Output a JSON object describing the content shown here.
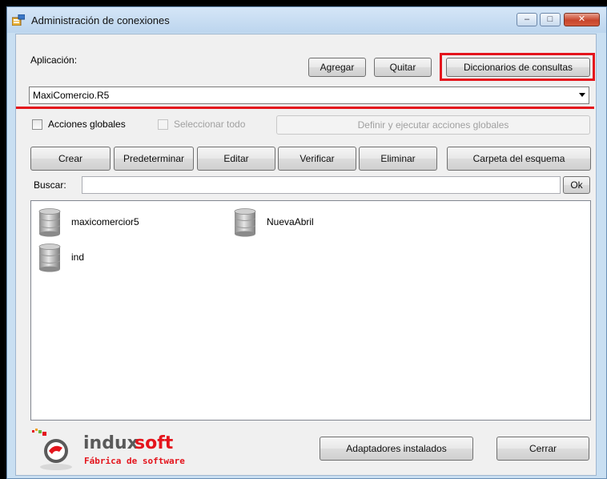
{
  "window": {
    "title": "Administración de conexiones"
  },
  "controls": {
    "minimize": "–",
    "maximize": "□",
    "close": "✕"
  },
  "application": {
    "label": "Aplicación:",
    "selected": "MaxiComercio.R5"
  },
  "top_buttons": {
    "add": "Agregar",
    "remove": "Quitar",
    "dictionaries": "Diccionarios de consultas"
  },
  "global_actions": {
    "checkbox_label": "Acciones globales",
    "select_all_label": "Seleccionar todo",
    "define_button": "Definir y ejecutar acciones globales"
  },
  "action_buttons": {
    "create": "Crear",
    "default": "Predeterminar",
    "edit": "Editar",
    "verify": "Verificar",
    "delete": "Eliminar",
    "schema_folder": "Carpeta del esquema"
  },
  "search": {
    "label": "Buscar:",
    "value": "",
    "ok": "Ok"
  },
  "connections": [
    {
      "name": "maxicomercior5",
      "icon": "database-icon"
    },
    {
      "name": "NuevaAbril",
      "icon": "database-icon"
    },
    {
      "name": "ind",
      "icon": "database-icon"
    }
  ],
  "logo": {
    "brand_a": "indux",
    "brand_b": "soft",
    "tagline": "Fábrica de software"
  },
  "bottom_buttons": {
    "adapters": "Adaptadores instalados",
    "close": "Cerrar"
  },
  "colors": {
    "highlight": "#e4141c",
    "titlebar": "#c9dff2",
    "client": "#f0f0f0"
  }
}
